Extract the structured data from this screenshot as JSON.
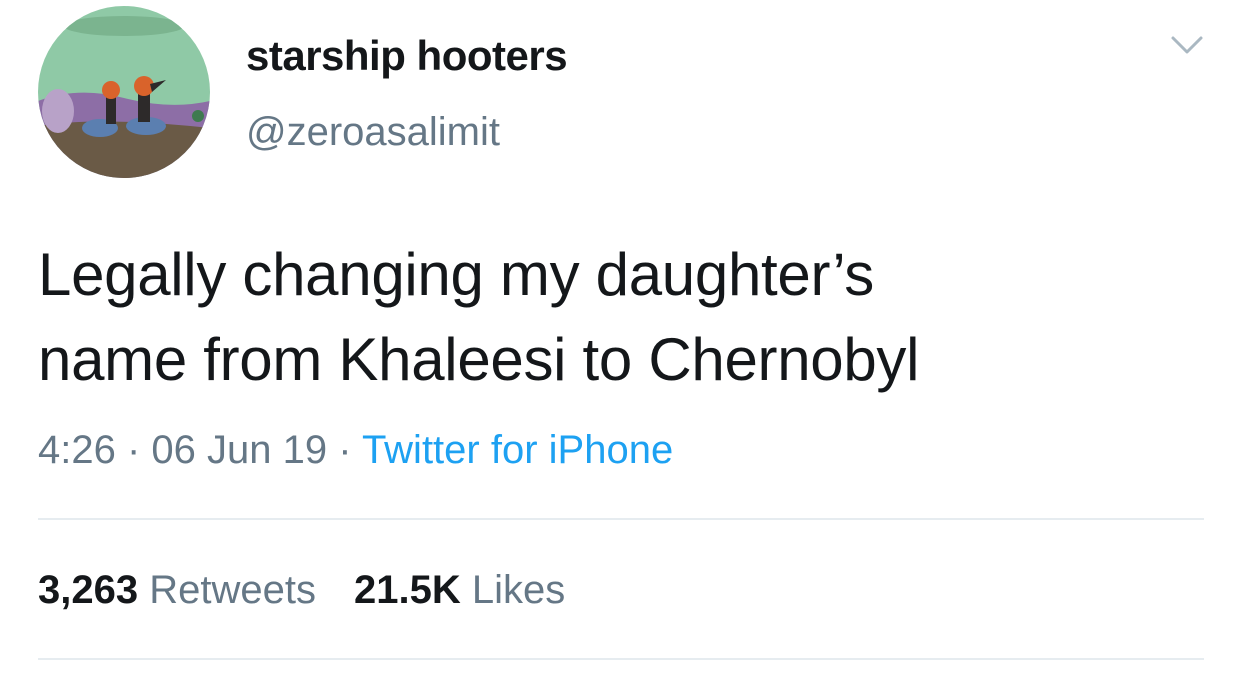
{
  "user": {
    "display_name": "starship hooters",
    "handle": "@zeroasalimit"
  },
  "tweet": {
    "lines": [
      "Legally changing my daughter’s",
      "name from Khaleesi to Chernobyl"
    ],
    "time": "4:26",
    "date": "06 Jun 19",
    "separator": " · ",
    "source": "Twitter for iPhone"
  },
  "stats": {
    "retweets_count": "3,263",
    "retweets_label": "Retweets",
    "likes_count": "21.5K",
    "likes_label": "Likes"
  },
  "icons": {
    "more": "chevron-down-icon",
    "avatar": "cartoon-avatar"
  },
  "colors": {
    "text": "#14171a",
    "secondary": "#657786",
    "link": "#1da1f2",
    "divider": "#e6ecf0"
  }
}
